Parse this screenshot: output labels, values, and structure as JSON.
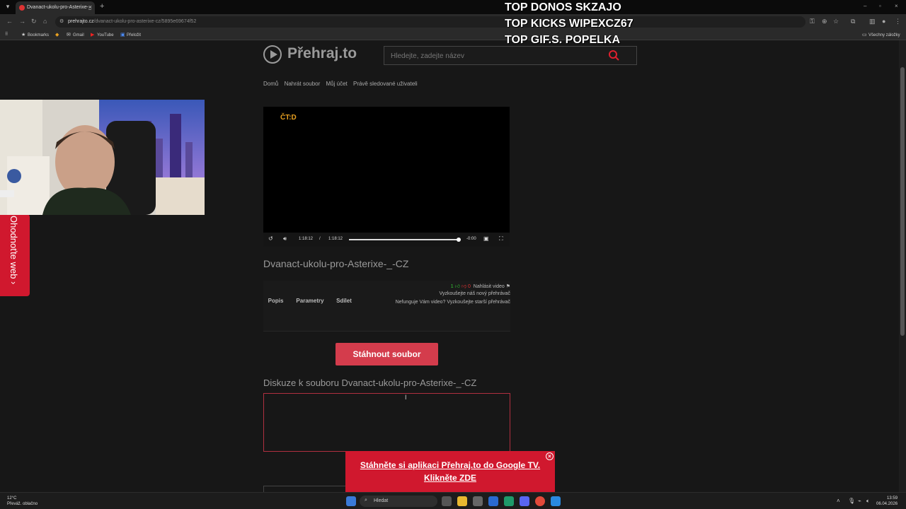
{
  "browser": {
    "tab_title": "Dvanact-ukolu-pro-Asterixe-_",
    "url_host": "prehrajto.cz",
    "url_path": "/dvanact-ukolu-pro-asterixe-cz/5895e69674f52",
    "bookmarks": [
      "Bookmarks",
      "Gmail",
      "YouTube",
      "Přeložit"
    ],
    "all_bookmarks": "Všechny záložky"
  },
  "overlay": {
    "lines": [
      "TOP DONOS SKZAJO",
      "TOP KICKS WIPEXCZ67",
      "TOP GIF.S.  POPELKA"
    ]
  },
  "site": {
    "logo": "Přehraj.to",
    "search_placeholder": "Hledejte, zadejte název",
    "nav": [
      "Domů",
      "Nahrát soubor",
      "Můj účet",
      "Právě sledované uživateli"
    ]
  },
  "video": {
    "channel_logo": "ČT:D",
    "time_current": "1:18:12",
    "time_sep": "/",
    "time_total": "1:18:12",
    "time_remaining": "-0:00",
    "progress": 1.0
  },
  "file": {
    "title": "Dvanact-ukolu-pro-Asterixe-_-CZ",
    "likes": "1",
    "dislikes": "0",
    "report": "Nahlásit video",
    "try_new": "Vyzkoušejte náš nový přehrávač",
    "try_old": "Nefunguje Vám video? Vyzkoušejte starší přehrávač",
    "tabs": [
      "Popis",
      "Parametry",
      "Sdílet"
    ],
    "download": "Stáhnout soubor",
    "discussion": "Diskuze k souboru Dvanact-ukolu-pro-Asterixe-_-CZ"
  },
  "promo": {
    "line1": "Stáhněte si aplikaci Přehraj.to do Google TV.",
    "line2": "Klikněte ZDE"
  },
  "sidetab": {
    "label": "Ohodnoťte web ›"
  },
  "taskbar": {
    "temp": "12°C",
    "weather": "Převáž. oblačno",
    "search": "Hledat",
    "time": "13:59",
    "date": "06.04.2026"
  }
}
